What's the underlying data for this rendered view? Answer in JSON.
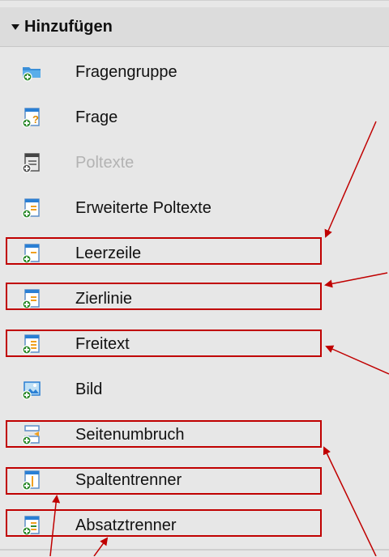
{
  "header": {
    "title": "Hinzufügen"
  },
  "items": [
    {
      "label": "Fragengruppe",
      "icon": "folder-add-icon"
    },
    {
      "label": "Frage",
      "icon": "question-page-add-icon"
    },
    {
      "label": "Poltexte",
      "icon": "page-disabled-icon",
      "disabled": true
    },
    {
      "label": "Erweiterte Poltexte",
      "icon": "page-add-icon"
    },
    {
      "label": "Leerzeile",
      "icon": "page-add-icon"
    },
    {
      "label": "Zierlinie",
      "icon": "page-add-icon"
    },
    {
      "label": "Freitext",
      "icon": "page-add-icon"
    },
    {
      "label": "Bild",
      "icon": "image-add-icon"
    },
    {
      "label": "Seitenumbruch",
      "icon": "page-break-add-icon"
    },
    {
      "label": "Spaltentrenner",
      "icon": "column-separator-add-icon"
    },
    {
      "label": "Absatztrenner",
      "icon": "paragraph-separator-add-icon"
    }
  ],
  "colors": {
    "highlight": "#c00000",
    "accent_green": "#2e8b2e",
    "accent_blue": "#2a7fd4",
    "accent_orange": "#f0a020"
  }
}
